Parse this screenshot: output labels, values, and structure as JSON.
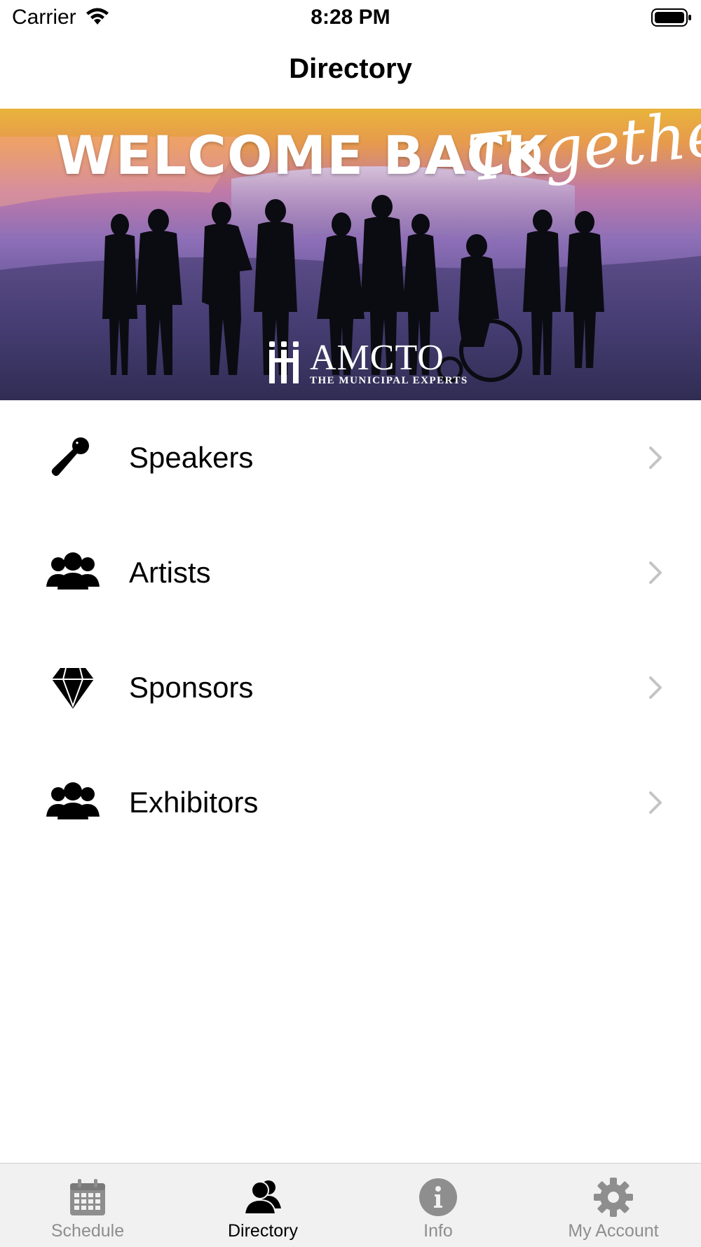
{
  "status_bar": {
    "carrier": "Carrier",
    "time": "8:28 PM"
  },
  "nav": {
    "title": "Directory"
  },
  "banner": {
    "headline": "WELCOME BACK",
    "script_word": "Together",
    "logo_name": "AMCTO",
    "logo_tagline": "THE MUNICIPAL EXPERTS"
  },
  "directory": {
    "items": [
      {
        "label": "Speakers",
        "icon": "microphone-icon"
      },
      {
        "label": "Artists",
        "icon": "group-icon"
      },
      {
        "label": "Sponsors",
        "icon": "diamond-icon"
      },
      {
        "label": "Exhibitors",
        "icon": "group-icon"
      }
    ]
  },
  "tab_bar": {
    "tabs": [
      {
        "label": "Schedule",
        "icon": "calendar-icon",
        "active": false
      },
      {
        "label": "Directory",
        "icon": "people-icon",
        "active": true
      },
      {
        "label": "Info",
        "icon": "info-icon",
        "active": false
      },
      {
        "label": "My Account",
        "icon": "gear-icon",
        "active": false
      }
    ]
  },
  "colors": {
    "active_tab": "#000000",
    "inactive_tab": "#8e8e8e",
    "chevron": "#c4c4c6",
    "tab_bar_bg": "#f1f1f1"
  }
}
